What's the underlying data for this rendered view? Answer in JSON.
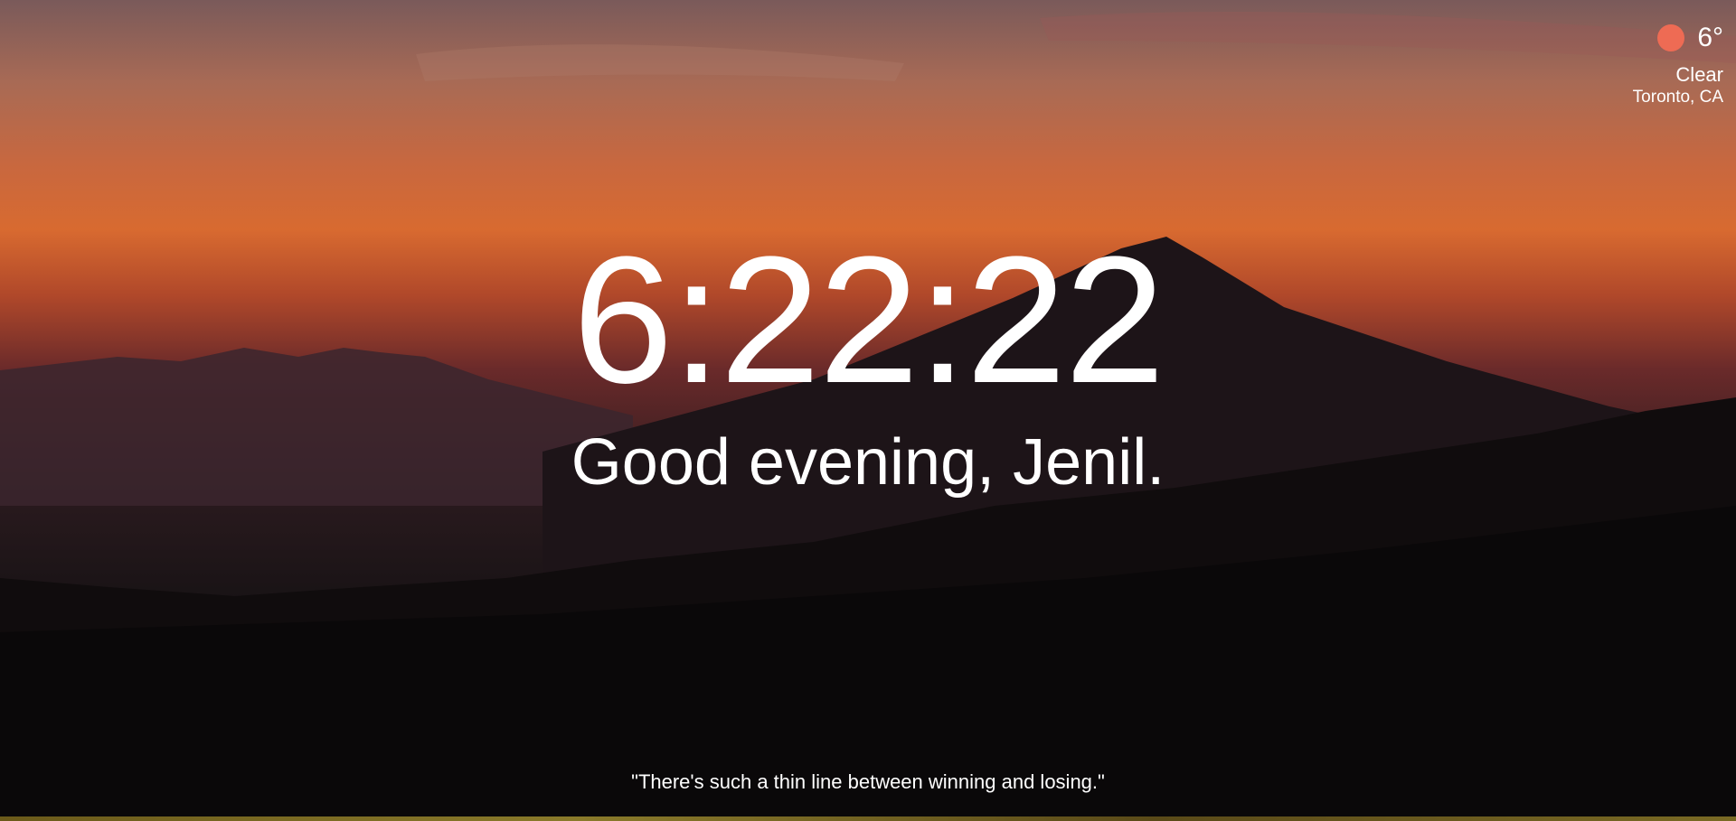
{
  "weather": {
    "icon": "sun-icon",
    "icon_color": "#ee6b54",
    "temperature": "6°",
    "condition": "Clear",
    "location": "Toronto, CA"
  },
  "clock": {
    "time": "6:22:22"
  },
  "greeting": {
    "text": "Good evening, Jenil."
  },
  "quote": {
    "text": "\"There's such a thin line between winning and losing.\""
  }
}
